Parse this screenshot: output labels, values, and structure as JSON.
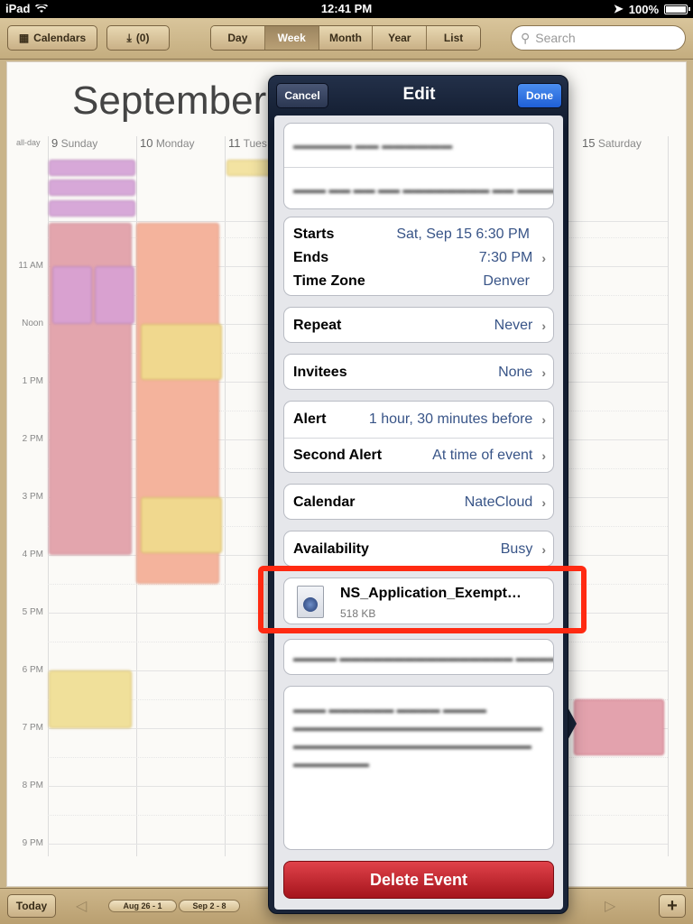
{
  "status": {
    "device": "iPad",
    "time": "12:41 PM",
    "battery": "100%"
  },
  "toolbar": {
    "calendars_label": "Calendars",
    "inbox_label": "(0)",
    "views": [
      "Day",
      "Week",
      "Month",
      "Year",
      "List"
    ],
    "active_view": "Week",
    "search_placeholder": "Search"
  },
  "calendar": {
    "month_title": "September",
    "allday_label": "all-day",
    "days": [
      {
        "num": "9",
        "name": "Sunday"
      },
      {
        "num": "10",
        "name": "Monday"
      },
      {
        "num": "11",
        "name": "Tues"
      },
      {
        "num": "15",
        "name": "Saturday"
      }
    ],
    "hours": [
      "11 AM",
      "Noon",
      "1 PM",
      "2 PM",
      "3 PM",
      "4 PM",
      "5 PM",
      "6 PM",
      "7 PM",
      "8 PM",
      "9 PM"
    ]
  },
  "popover": {
    "title": "Edit",
    "cancel_label": "Cancel",
    "done_label": "Done",
    "starts_label": "Starts",
    "starts_value": "Sat, Sep 15  6:30 PM",
    "ends_label": "Ends",
    "ends_value": "7:30 PM",
    "timezone_label": "Time Zone",
    "timezone_value": "Denver",
    "repeat_label": "Repeat",
    "repeat_value": "Never",
    "invitees_label": "Invitees",
    "invitees_value": "None",
    "alert_label": "Alert",
    "alert_value": "1 hour, 30 minutes before",
    "second_alert_label": "Second Alert",
    "second_alert_value": "At time of event",
    "calendar_label": "Calendar",
    "calendar_value": "NateCloud",
    "availability_label": "Availability",
    "availability_value": "Busy",
    "attachment_name": "NS_Application_Exempt…",
    "attachment_size": "518 KB",
    "delete_label": "Delete Event"
  },
  "bottombar": {
    "today_label": "Today",
    "weeks": [
      "Aug 26 - 1",
      "Sep 2 - 8"
    ]
  }
}
